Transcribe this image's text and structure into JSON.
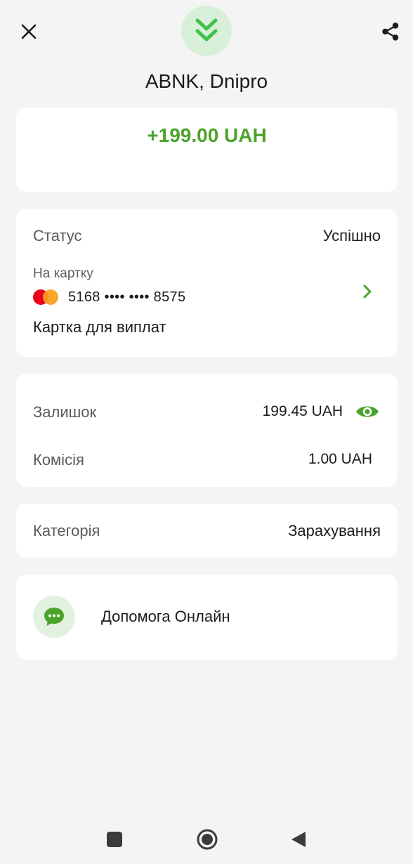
{
  "header": {
    "close_icon": "close-icon",
    "badge_icon": "double-chevron-down-icon",
    "share_icon": "share-icon",
    "merchant": "ABNK, Dnipro"
  },
  "amount": {
    "value": "+199.00 UAH"
  },
  "status_card": {
    "status_label": "Статус",
    "status_value": "Успішно",
    "to_card_label": "На картку",
    "card_number": "5168 •••• •••• 8575",
    "card_name": "Картка для виплат"
  },
  "balance_card": {
    "balance_label": "Залишок",
    "balance_value": "199.45 UAH",
    "fee_label": "Комісія",
    "fee_value": "1.00 UAH"
  },
  "category_card": {
    "category_label": "Категорія",
    "category_value": "Зарахування"
  },
  "help_card": {
    "help_label": "Допомога Онлайн"
  },
  "colors": {
    "accent_green": "#4ca32b",
    "badge_bg": "#d9f0d8",
    "background": "#f4f4f4"
  }
}
